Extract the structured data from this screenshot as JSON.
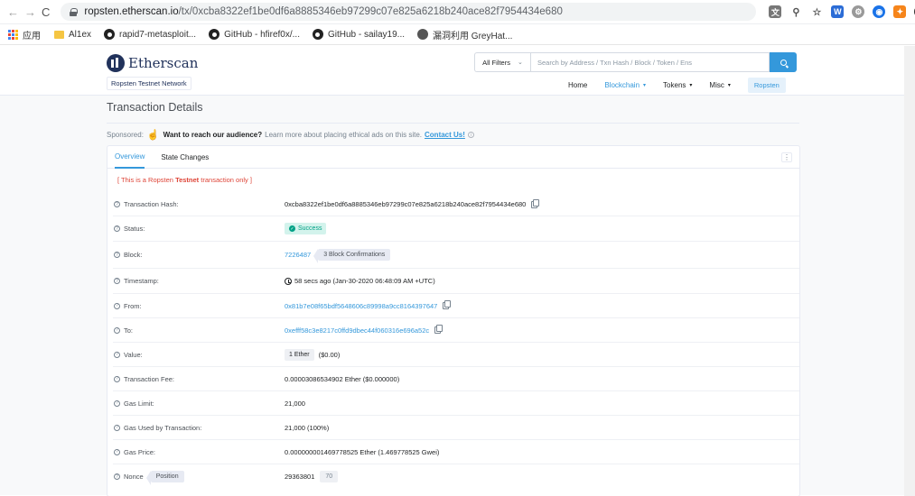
{
  "browser": {
    "back": "←",
    "forward": "→",
    "reload": "C",
    "url_host": "ropsten.etherscan.io",
    "url_path": "/tx/0xcba8322ef1be0df6a8885346eb97299c07e825a6218b240ace82f7954434e680"
  },
  "bookmarks": [
    {
      "label": "应用",
      "icon": "apps-grid-icon"
    },
    {
      "label": "Al1ex",
      "icon": "folder-icon"
    },
    {
      "label": "rapid7-metasploit...",
      "icon": "github-icon"
    },
    {
      "label": "GitHub - hfiref0x/...",
      "icon": "github-icon"
    },
    {
      "label": "GitHub - sailay19...",
      "icon": "github-icon"
    },
    {
      "label": "漏洞利用 GreyHat...",
      "icon": "globe-icon"
    }
  ],
  "header": {
    "logo_text": "Etherscan",
    "network": "Ropsten Testnet Network",
    "filter_label": "All Filters",
    "search_placeholder": "Search by Address / Txn Hash / Block / Token / Ens",
    "nav": {
      "home": "Home",
      "blockchain": "Blockchain",
      "tokens": "Tokens",
      "misc": "Misc",
      "network_button": "Ropsten"
    }
  },
  "page": {
    "title": "Transaction Details",
    "sponsor_prefix": "Sponsored:",
    "sponsor_bold": "Want to reach our audience?",
    "sponsor_text": "Learn more about placing ethical ads on this site.",
    "sponsor_link": "Contact Us!",
    "tabs": [
      "Overview",
      "State Changes"
    ],
    "testnet_pre": "[ This is a Ropsten ",
    "testnet_bold": "Testnet",
    "testnet_post": " transaction only ]"
  },
  "details": {
    "hash_label": "Transaction Hash:",
    "hash": "0xcba8322ef1be0df6a8885346eb97299c07e825a6218b240ace82f7954434e680",
    "status_label": "Status:",
    "status": "Success",
    "block_label": "Block:",
    "block": "7226487",
    "confirmations": "3 Block Confirmations",
    "timestamp_label": "Timestamp:",
    "timestamp": "58 secs ago (Jan-30-2020 06:48:09 AM +UTC)",
    "from_label": "From:",
    "from": "0x81b7e08f65bdf5648606c89998a9cc8164397647",
    "to_label": "To:",
    "to": "0xefff58c3e8217c0ffd9dbec44f060316e696a52c",
    "value_label": "Value:",
    "value_eth": "1 Ether",
    "value_usd": "($0.00)",
    "fee_label": "Transaction Fee:",
    "fee": "0.00003086534902 Ether ($0.000000)",
    "gas_limit_label": "Gas Limit:",
    "gas_limit": "21,000",
    "gas_used_label": "Gas Used by Transaction:",
    "gas_used": "21,000 (100%)",
    "gas_price_label": "Gas Price:",
    "gas_price": "0.000000001469778525 Ether (1.469778525 Gwei)",
    "nonce_label": "Nonce",
    "nonce_position_label": "Position",
    "nonce": "29363801",
    "position": "70"
  },
  "colors": {
    "accent": "#3498db",
    "success": "#00a186",
    "testnet_red": "#de4437",
    "brand_navy": "#21325b"
  }
}
